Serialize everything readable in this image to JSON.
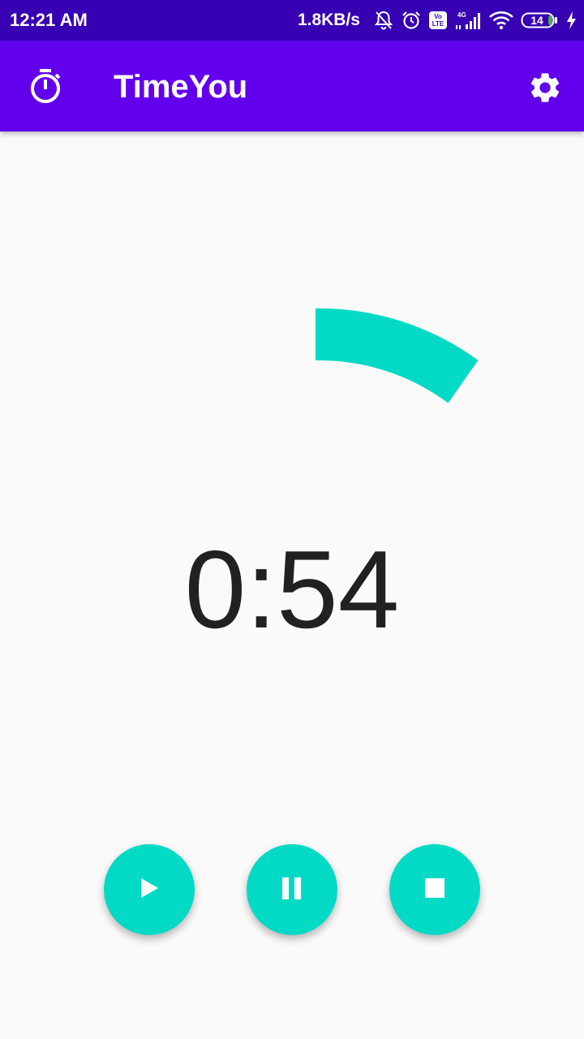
{
  "status_bar": {
    "time": "12:21 AM",
    "network_speed": "1.8KB/s",
    "network_type": "4G",
    "volte_badge": "Vo LTE",
    "battery_level": "14",
    "icons": [
      "bell-off-icon",
      "alarm-icon",
      "volte-icon",
      "signal-icon",
      "wifi-icon",
      "battery-icon",
      "charging-icon"
    ]
  },
  "app_bar": {
    "title": "TimeYou",
    "left_icon": "stopwatch-icon",
    "right_icon": "settings-gear-icon"
  },
  "timer": {
    "display": "0:54",
    "progress_color": "#03dac5"
  },
  "controls": {
    "buttons": [
      {
        "name": "play",
        "icon": "play-icon"
      },
      {
        "name": "pause",
        "icon": "pause-icon"
      },
      {
        "name": "stop",
        "icon": "stop-icon"
      }
    ]
  },
  "colors": {
    "status_bar": "#3700b3",
    "app_bar": "#6200ee",
    "accent": "#03dac5",
    "background": "#fafafa",
    "timer_text": "#212121"
  }
}
